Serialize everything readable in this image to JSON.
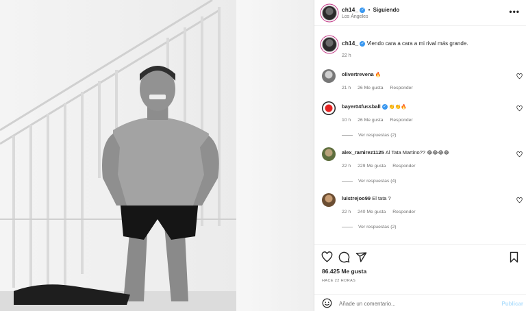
{
  "post": {
    "author": "ch14_",
    "dot": "•",
    "follow_status": "Siguiendo",
    "location": "Los Ángeles",
    "caption_text": "Viendo cara a cara a mi rival más grande.",
    "caption_time": "22 h",
    "likes": "86.425 Me gusta",
    "date": "HACE 22 HORAS",
    "comment_placeholder": "Añade un comentario...",
    "publish_label": "Publicar",
    "more_label": "•••"
  },
  "comments": [
    {
      "user": "olivertrevena",
      "text": "",
      "emoji": "🔥",
      "time": "21 h",
      "likes": "26 Me gusta",
      "reply": "Responder",
      "view_replies": ""
    },
    {
      "user": "bayer04fussball",
      "text": "",
      "emoji": "👏👏🔥",
      "time": "10 h",
      "likes": "26 Me gusta",
      "reply": "Responder",
      "view_replies": "Ver respuestas (2)"
    },
    {
      "user": "alex_ramirez1125",
      "text": "Al Tata Martino??",
      "emoji": "😂😂😂😂",
      "time": "22 h",
      "likes": "229 Me gusta",
      "reply": "Responder",
      "view_replies": "Ver respuestas (4)"
    },
    {
      "user": "luistrejoo99",
      "text": "El tata ?",
      "emoji": "",
      "time": "22 h",
      "likes": "240 Me gusta",
      "reply": "Responder",
      "view_replies": "Ver respuestas (2)"
    }
  ],
  "icons": {
    "more": "more-options-icon",
    "like": "heart-icon",
    "comment": "comment-icon",
    "share": "share-icon",
    "save": "bookmark-icon",
    "emoji": "emoji-icon",
    "verified": "verified-badge-icon"
  },
  "colors": {
    "verified": "#3897f0",
    "publish": "#b2dffc",
    "muted": "#737373",
    "text": "#262626"
  }
}
